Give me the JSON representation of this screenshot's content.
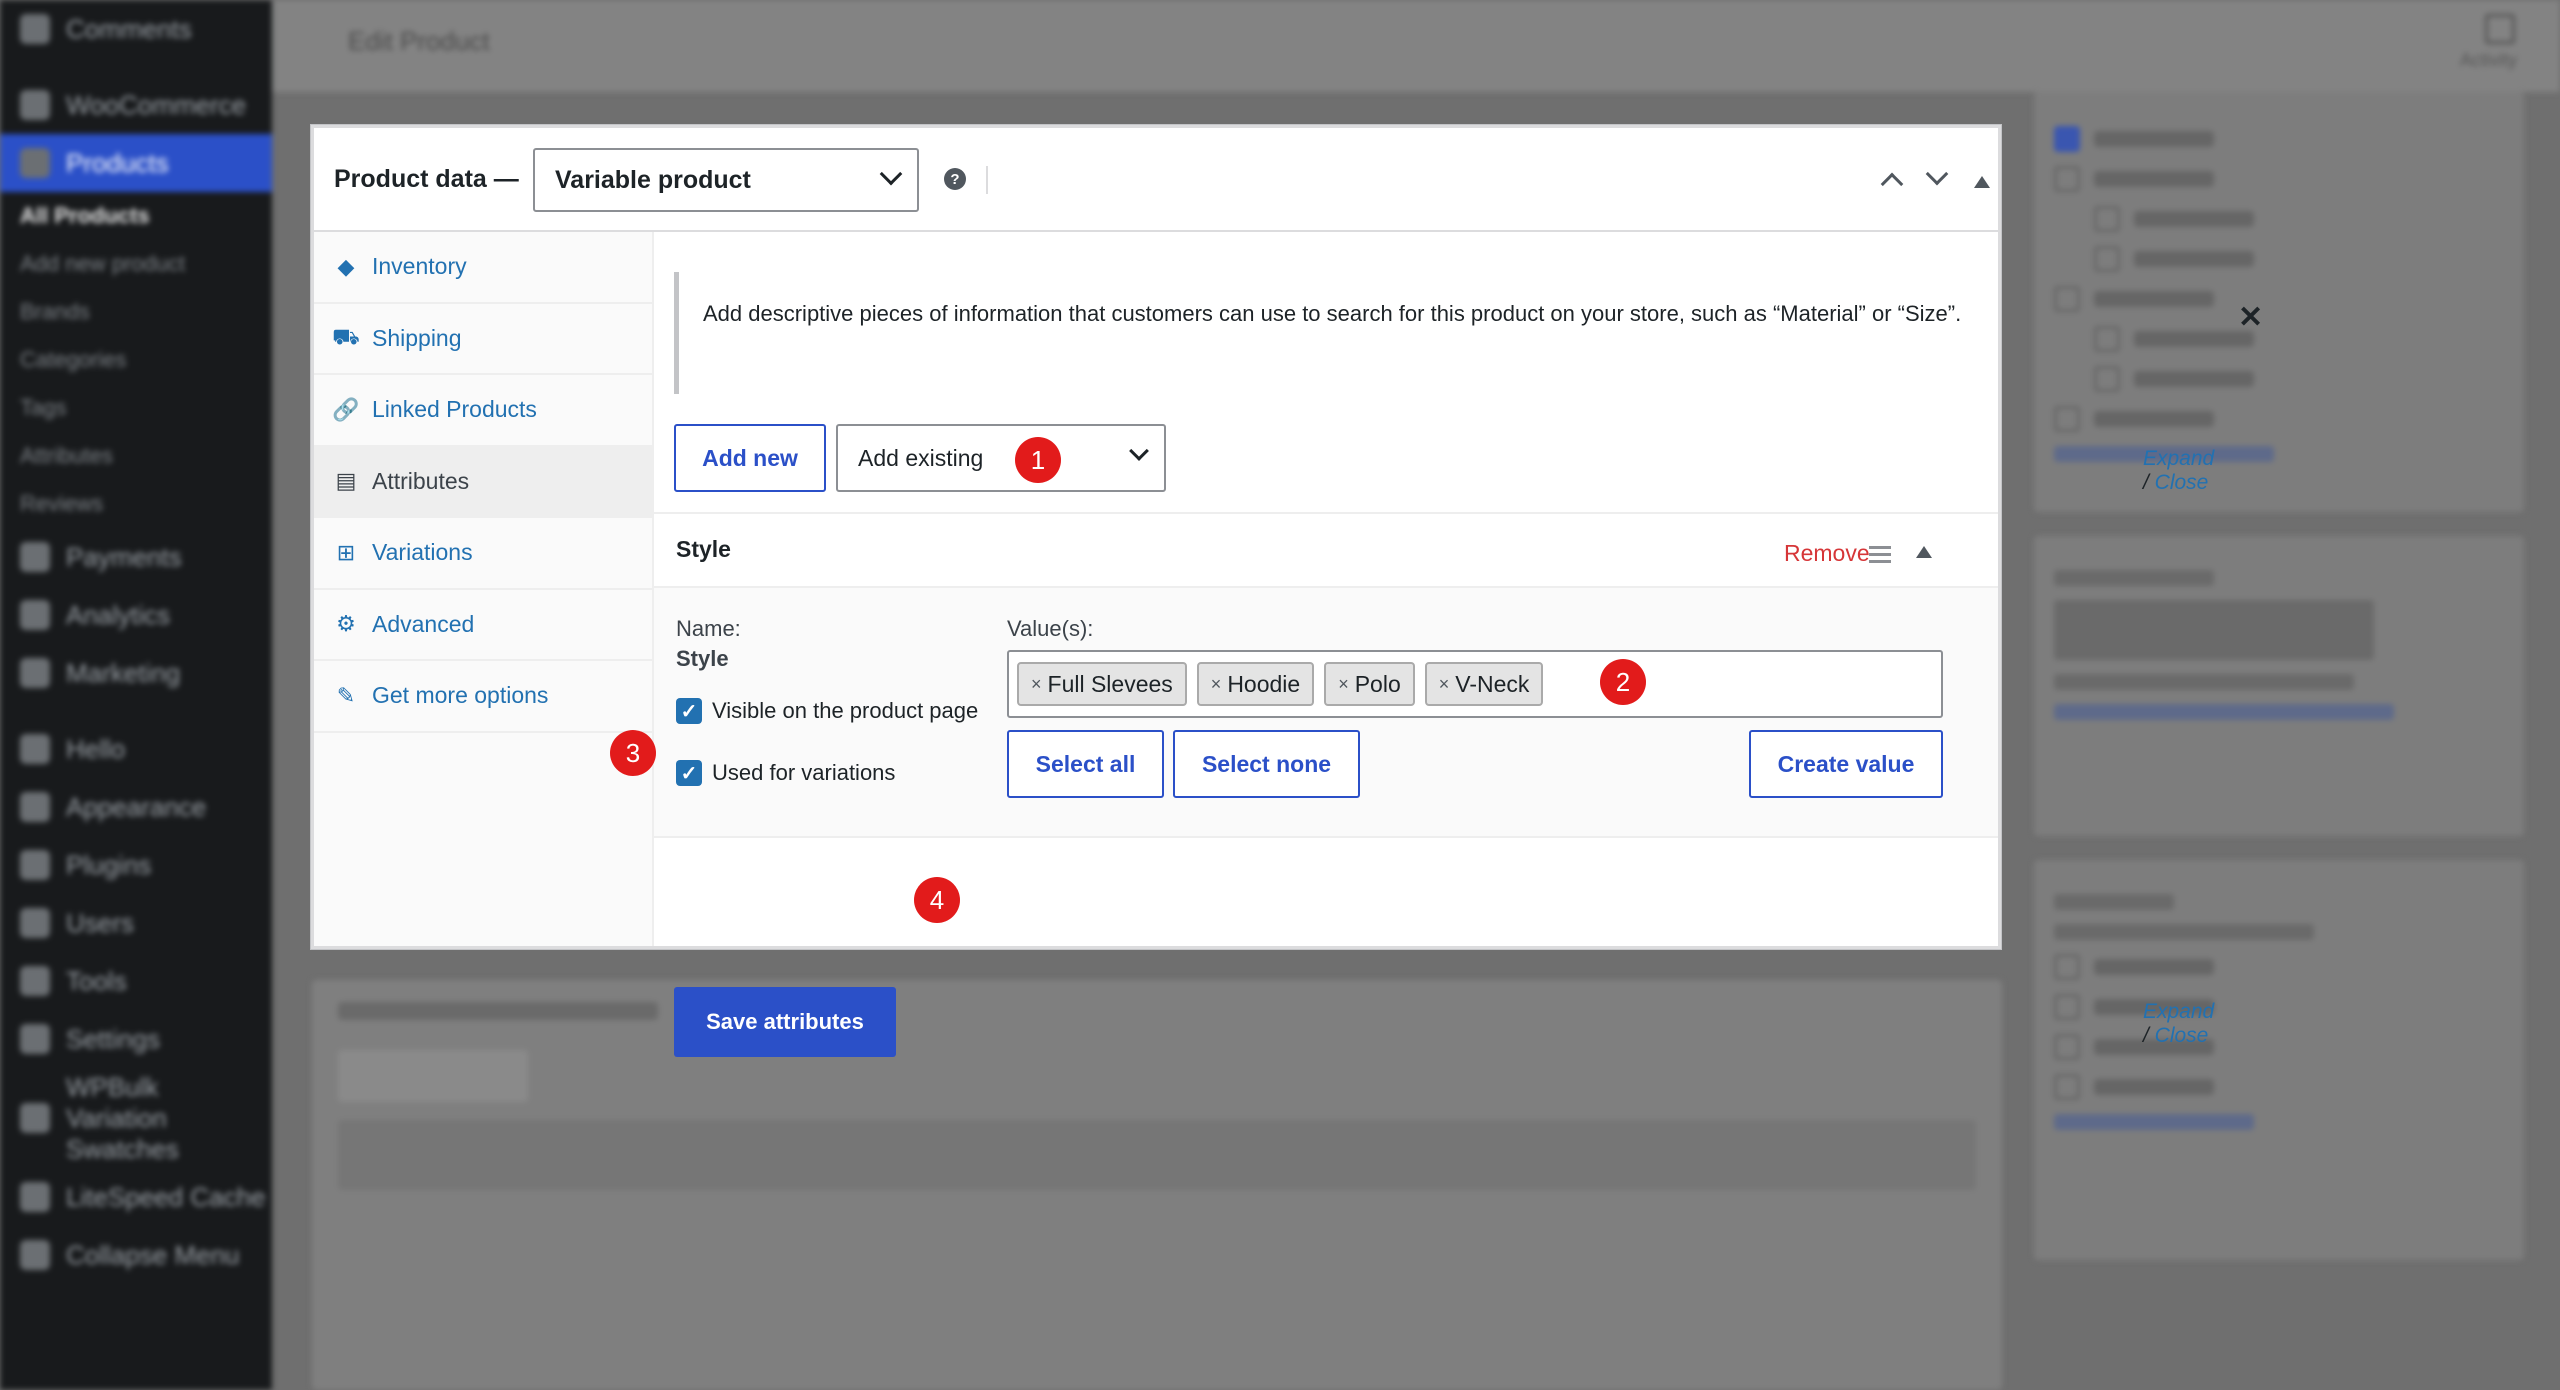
{
  "background": {
    "sidebar_items": [
      "Comments",
      "WooCommerce",
      "Products",
      "All Products",
      "Add new product",
      "Brands",
      "Categories",
      "Tags",
      "Attributes",
      "Reviews",
      "Payments",
      "Analytics",
      "Marketing",
      "Hello",
      "Appearance",
      "Plugins",
      "Users",
      "Tools",
      "Settings",
      "WPBulk Variation Swatches",
      "LiteSpeed Cache",
      "Collapse Menu"
    ],
    "page_title": "Edit Product",
    "top_action": "Activity"
  },
  "product_data": {
    "title": "Product data —",
    "product_type": "Variable product",
    "help": "?",
    "tabs": [
      {
        "label": "Inventory",
        "icon": "◆"
      },
      {
        "label": "Shipping",
        "icon": "⛟"
      },
      {
        "label": "Linked Products",
        "icon": "🔗"
      },
      {
        "label": "Attributes",
        "icon": "▤"
      },
      {
        "label": "Variations",
        "icon": "⊞"
      },
      {
        "label": "Advanced",
        "icon": "⚙"
      },
      {
        "label": "Get more options",
        "icon": "✎"
      }
    ]
  },
  "attributes": {
    "notice": "Add descriptive pieces of information that customers can use to search for this product on your store, such as “Material” or “Size”.",
    "notice_close": "✕",
    "add_new": "Add new",
    "add_existing": "Add existing",
    "expand": "Expand",
    "slash": " / ",
    "close": "Close",
    "attr_name": "Style",
    "remove": "Remove",
    "name_label": "Name:",
    "name_value": "Style",
    "values_label": "Value(s):",
    "values": [
      "Full Slevees",
      "Hoodie",
      "Polo",
      "V-Neck"
    ],
    "visible_label": "Visible on the product page",
    "variations_label": "Used for variations",
    "select_all": "Select all",
    "select_none": "Select none",
    "create_value": "Create value",
    "save": "Save attributes"
  },
  "badges": [
    "1",
    "2",
    "3",
    "4"
  ],
  "colors": {
    "accent": "#2b50c8",
    "link": "#2271b1",
    "danger": "#d63638",
    "badge": "#e21b1b"
  }
}
